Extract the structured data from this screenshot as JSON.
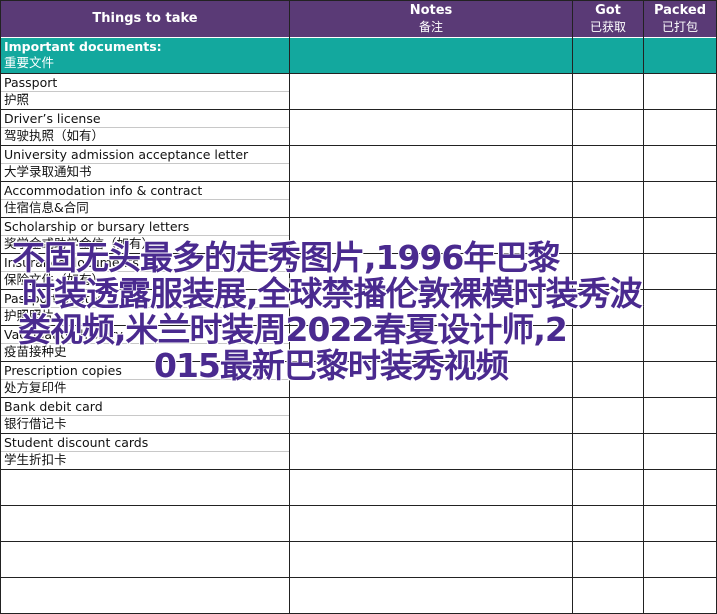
{
  "header": {
    "things": "Things to take",
    "notes_en": "Notes",
    "notes_zh": "备注",
    "got_en": "Got",
    "got_zh": "已获取",
    "packed_en": "Packed",
    "packed_zh": "已打包"
  },
  "section": {
    "title_en": "Important documents:",
    "title_zh": "重要文件"
  },
  "items": [
    {
      "en": "Passport",
      "zh": "护照"
    },
    {
      "en": "Driver’s license",
      "zh": "驾驶执照（如有）"
    },
    {
      "en": "University admission acceptance letter",
      "zh": "大学录取通知书"
    },
    {
      "en": "Accommodation info & contract",
      "zh": "住宿信息&合同"
    },
    {
      "en": "Scholarship or bursary letters",
      "zh": "奖学金或助学金信（如有）"
    },
    {
      "en": "Insurance documents",
      "zh": "保险文件（如有）"
    },
    {
      "en": "Passport photos",
      "zh": "护照照片"
    },
    {
      "en": "Vaccination history",
      "zh": "疫苗接种史"
    },
    {
      "en": "Prescription copies",
      "zh": "处方复印件"
    },
    {
      "en": "Bank debit card",
      "zh": "银行借记卡"
    },
    {
      "en": "Student discount cards",
      "zh": "学生折扣卡"
    },
    {
      "en": "",
      "zh": ""
    },
    {
      "en": "",
      "zh": ""
    },
    {
      "en": "",
      "zh": ""
    },
    {
      "en": "",
      "zh": ""
    }
  ],
  "watermark": {
    "line1": "不固无头最多的走秀图片,1996年巴黎",
    "line2": "时装透露服装展,全球禁播伦敦裸模时装秀波",
    "line3": "娄视频,米兰时装周2022春夏设计师,2",
    "line4": "015最新巴黎时装秀视频"
  },
  "colors": {
    "header_bg": "#5a3a76",
    "section_bg": "#13a89e",
    "watermark": "#4a2a8f"
  }
}
